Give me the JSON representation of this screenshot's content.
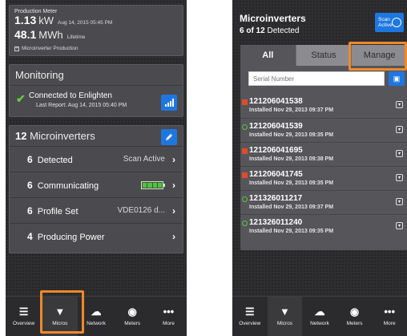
{
  "left": {
    "production": {
      "title": "Production Meter",
      "today_value": "1.13",
      "today_unit": "kW",
      "today_meta": "Aug 14, 2015 05:45 PM",
      "lifetime_value": "48.1",
      "lifetime_unit": "MWh",
      "lifetime_label": "Lifetime",
      "toggle_label": "Microinverter Production"
    },
    "monitoring": {
      "title": "Monitoring",
      "status": "Connected to Enlighten",
      "last_report": "Last Report: Aug 14, 2015 05:40 PM"
    },
    "micros": {
      "count": "12",
      "title": "Microinverters",
      "rows": [
        {
          "num": "6",
          "label": "Detected",
          "value": "Scan Active"
        },
        {
          "num": "6",
          "label": "Communicating",
          "value": ""
        },
        {
          "num": "6",
          "label": "Profile Set",
          "value": "VDE0126 d..."
        },
        {
          "num": "4",
          "label": "Producing Power",
          "value": ""
        }
      ]
    }
  },
  "nav": [
    {
      "label": "Overview",
      "icon": "list-icon"
    },
    {
      "label": "Micros",
      "icon": "micro-icon"
    },
    {
      "label": "Network",
      "icon": "cloud-icon"
    },
    {
      "label": "Meters",
      "icon": "meter-icon"
    },
    {
      "label": "More",
      "icon": "more-icon"
    }
  ],
  "right": {
    "title": "Microinverters",
    "detected_count": "6 of 12",
    "detected_label": "Detected",
    "scan_line1": "Scan",
    "scan_line2": "Active",
    "tabs": [
      "All",
      "Status",
      "Manage"
    ],
    "search_placeholder": "Serial Number",
    "items": [
      {
        "serial": "121206041538",
        "installed": "Installed Nov 29, 2013 09:37 PM",
        "status": "error"
      },
      {
        "serial": "121206041539",
        "installed": "Installed Nov 29, 2013 09:35 PM",
        "status": "ok"
      },
      {
        "serial": "121206041695",
        "installed": "Installed Nov 29, 2013 09:38 PM",
        "status": "error"
      },
      {
        "serial": "121206041745",
        "installed": "Installed Nov 29, 2013 09:35 PM",
        "status": "error"
      },
      {
        "serial": "121326011217",
        "installed": "Installed Nov 29, 2013 09:37 PM",
        "status": "ok"
      },
      {
        "serial": "121326011240",
        "installed": "Installed Nov 29, 2013 09:35 PM",
        "status": "ok"
      }
    ]
  },
  "colors": {
    "accent": "#1e77e0",
    "highlight": "#f0882a",
    "ok": "#58c739",
    "error": "#e04b2b"
  }
}
